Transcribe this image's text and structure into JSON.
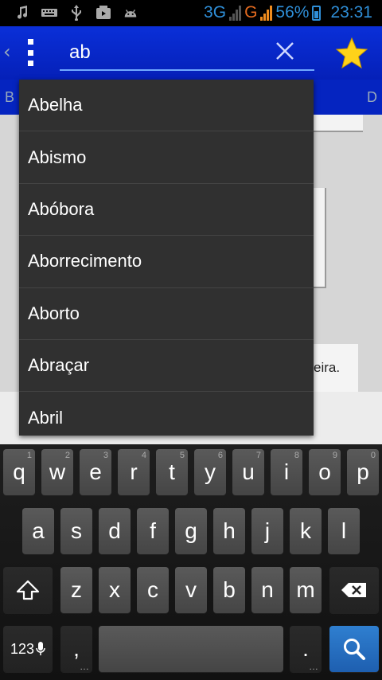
{
  "status_bar": {
    "net_3g": "3G",
    "net_g": "G",
    "battery": "56%",
    "time": "23:31",
    "icons": [
      "music-icon",
      "keyboard-icon",
      "usb-icon",
      "video-icon",
      "android-icon"
    ]
  },
  "action_bar": {
    "search_value": "ab",
    "accent": "#0a2fd8"
  },
  "tabs": {
    "left_label": "B",
    "right_label": "D"
  },
  "content": {
    "card_text": "eira."
  },
  "suggestions": [
    "Abelha",
    "Abismo",
    "Abóbora",
    "Aborrecimento",
    "Aborto",
    "Abraçar",
    "Abril"
  ],
  "keyboard": {
    "row1": [
      {
        "k": "q",
        "h": "1"
      },
      {
        "k": "w",
        "h": "2"
      },
      {
        "k": "e",
        "h": "3"
      },
      {
        "k": "r",
        "h": "4"
      },
      {
        "k": "t",
        "h": "5"
      },
      {
        "k": "y",
        "h": "6"
      },
      {
        "k": "u",
        "h": "7"
      },
      {
        "k": "i",
        "h": "8"
      },
      {
        "k": "o",
        "h": "9"
      },
      {
        "k": "p",
        "h": "0"
      }
    ],
    "row2": [
      "a",
      "s",
      "d",
      "f",
      "g",
      "h",
      "j",
      "k",
      "l"
    ],
    "row3": [
      "z",
      "x",
      "c",
      "v",
      "b",
      "n",
      "m"
    ],
    "symbols_label": "123",
    "comma": ",",
    "period": "."
  }
}
